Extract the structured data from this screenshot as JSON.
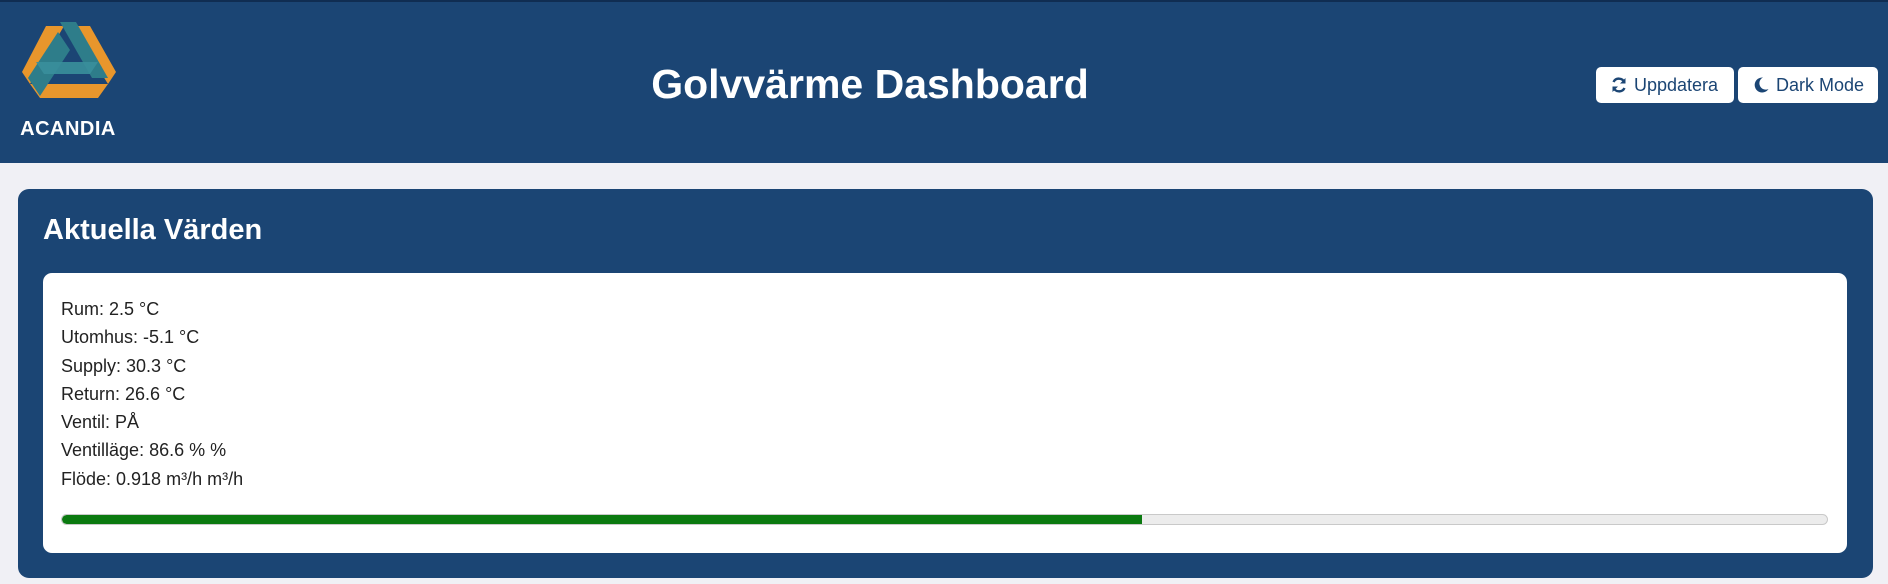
{
  "header": {
    "logo_text": "ACANDIA",
    "title": "Golvvärme Dashboard",
    "refresh_button": {
      "label": "Uppdatera",
      "icon": "refresh-icon"
    },
    "dark_mode_button": {
      "label": "Dark Mode",
      "icon": "moon-icon"
    }
  },
  "current_values": {
    "title": "Aktuella Värden",
    "lines": [
      "Rum: 2.5 °C",
      "Utomhus: -5.1 °C",
      "Supply: 30.3 °C",
      "Return: 26.6 °C",
      "Ventil: PÅ",
      "Ventilläge: 86.6 % %",
      "Flöde: 0.918 m³/h m³/h"
    ],
    "progress_fraction": 0.612
  },
  "colors": {
    "brand": "#1b4574",
    "background": "#f0f0f5",
    "progress_fill": "#0b7a10",
    "logo_orange": "#e8962c",
    "logo_teal": "#2e7d8a"
  }
}
